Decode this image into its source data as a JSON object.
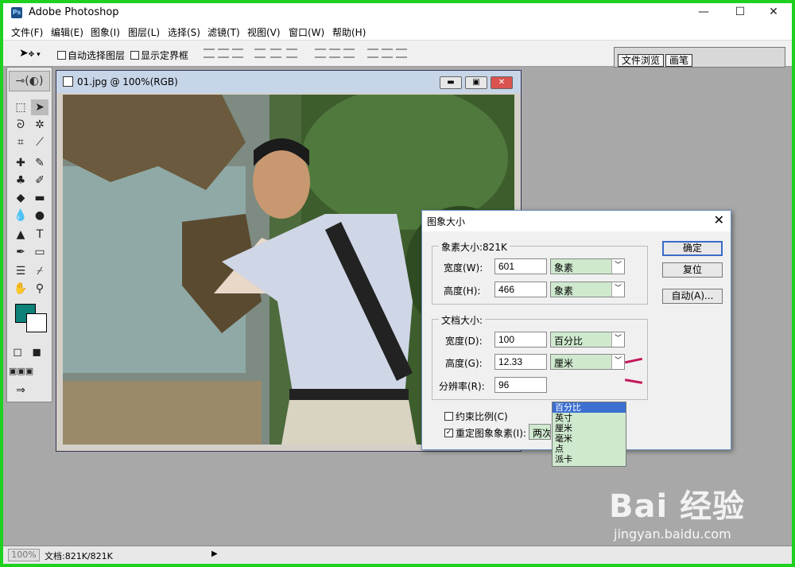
{
  "app": {
    "title": "Adobe Photoshop",
    "icon": "photoshop-icon"
  },
  "window_controls": {
    "minimize": "—",
    "maximize": "☐",
    "close": "✕"
  },
  "menu": [
    "文件(F)",
    "编辑(E)",
    "图象(I)",
    "图层(L)",
    "选择(S)",
    "滤镜(T)",
    "视图(V)",
    "窗口(W)",
    "帮助(H)"
  ],
  "options_bar": {
    "auto_select_layer": "自动选择图层",
    "show_bounding_box": "显示定界框"
  },
  "palette_well": {
    "tabs": [
      "文件浏览",
      "画笔"
    ]
  },
  "colors": {
    "foreground": "#0e8178",
    "background": "#ffffff",
    "accent_border": "#1fd11f",
    "selection": "#3b6fd1",
    "annotation_arrow": "#c2185b"
  },
  "document": {
    "title": "01.jpg @ 100%(RGB)"
  },
  "dialog": {
    "title": "图象大小",
    "pixel_group": {
      "label": "象素大小:821K",
      "width_label": "宽度(W):",
      "width_value": "601",
      "width_unit": "象素",
      "height_label": "高度(H):",
      "height_value": "466",
      "height_unit": "象素"
    },
    "doc_group": {
      "label": "文档大小:",
      "width_label": "宽度(D):",
      "width_value": "100",
      "width_unit": "百分比",
      "height_label": "高度(G):",
      "height_value": "12.33",
      "height_unit": "厘米",
      "resolution_label": "分辨率(R):",
      "resolution_value": "96"
    },
    "unit_options": [
      "百分比",
      "英寸",
      "厘米",
      "毫米",
      "点",
      "派卡"
    ],
    "constrain_label": "约束比例(C)",
    "constrain_checked": false,
    "resample_label": "重定图象象素(I):",
    "resample_checked": true,
    "resample_method": "两次",
    "buttons": {
      "ok": "确定",
      "reset": "复位",
      "auto": "自动(A)..."
    }
  },
  "statusbar": {
    "zoom": "100%",
    "doc_size": "文档:821K/821K"
  },
  "watermark": {
    "logo": "Bai 经验",
    "url": "jingyan.baidu.com"
  }
}
